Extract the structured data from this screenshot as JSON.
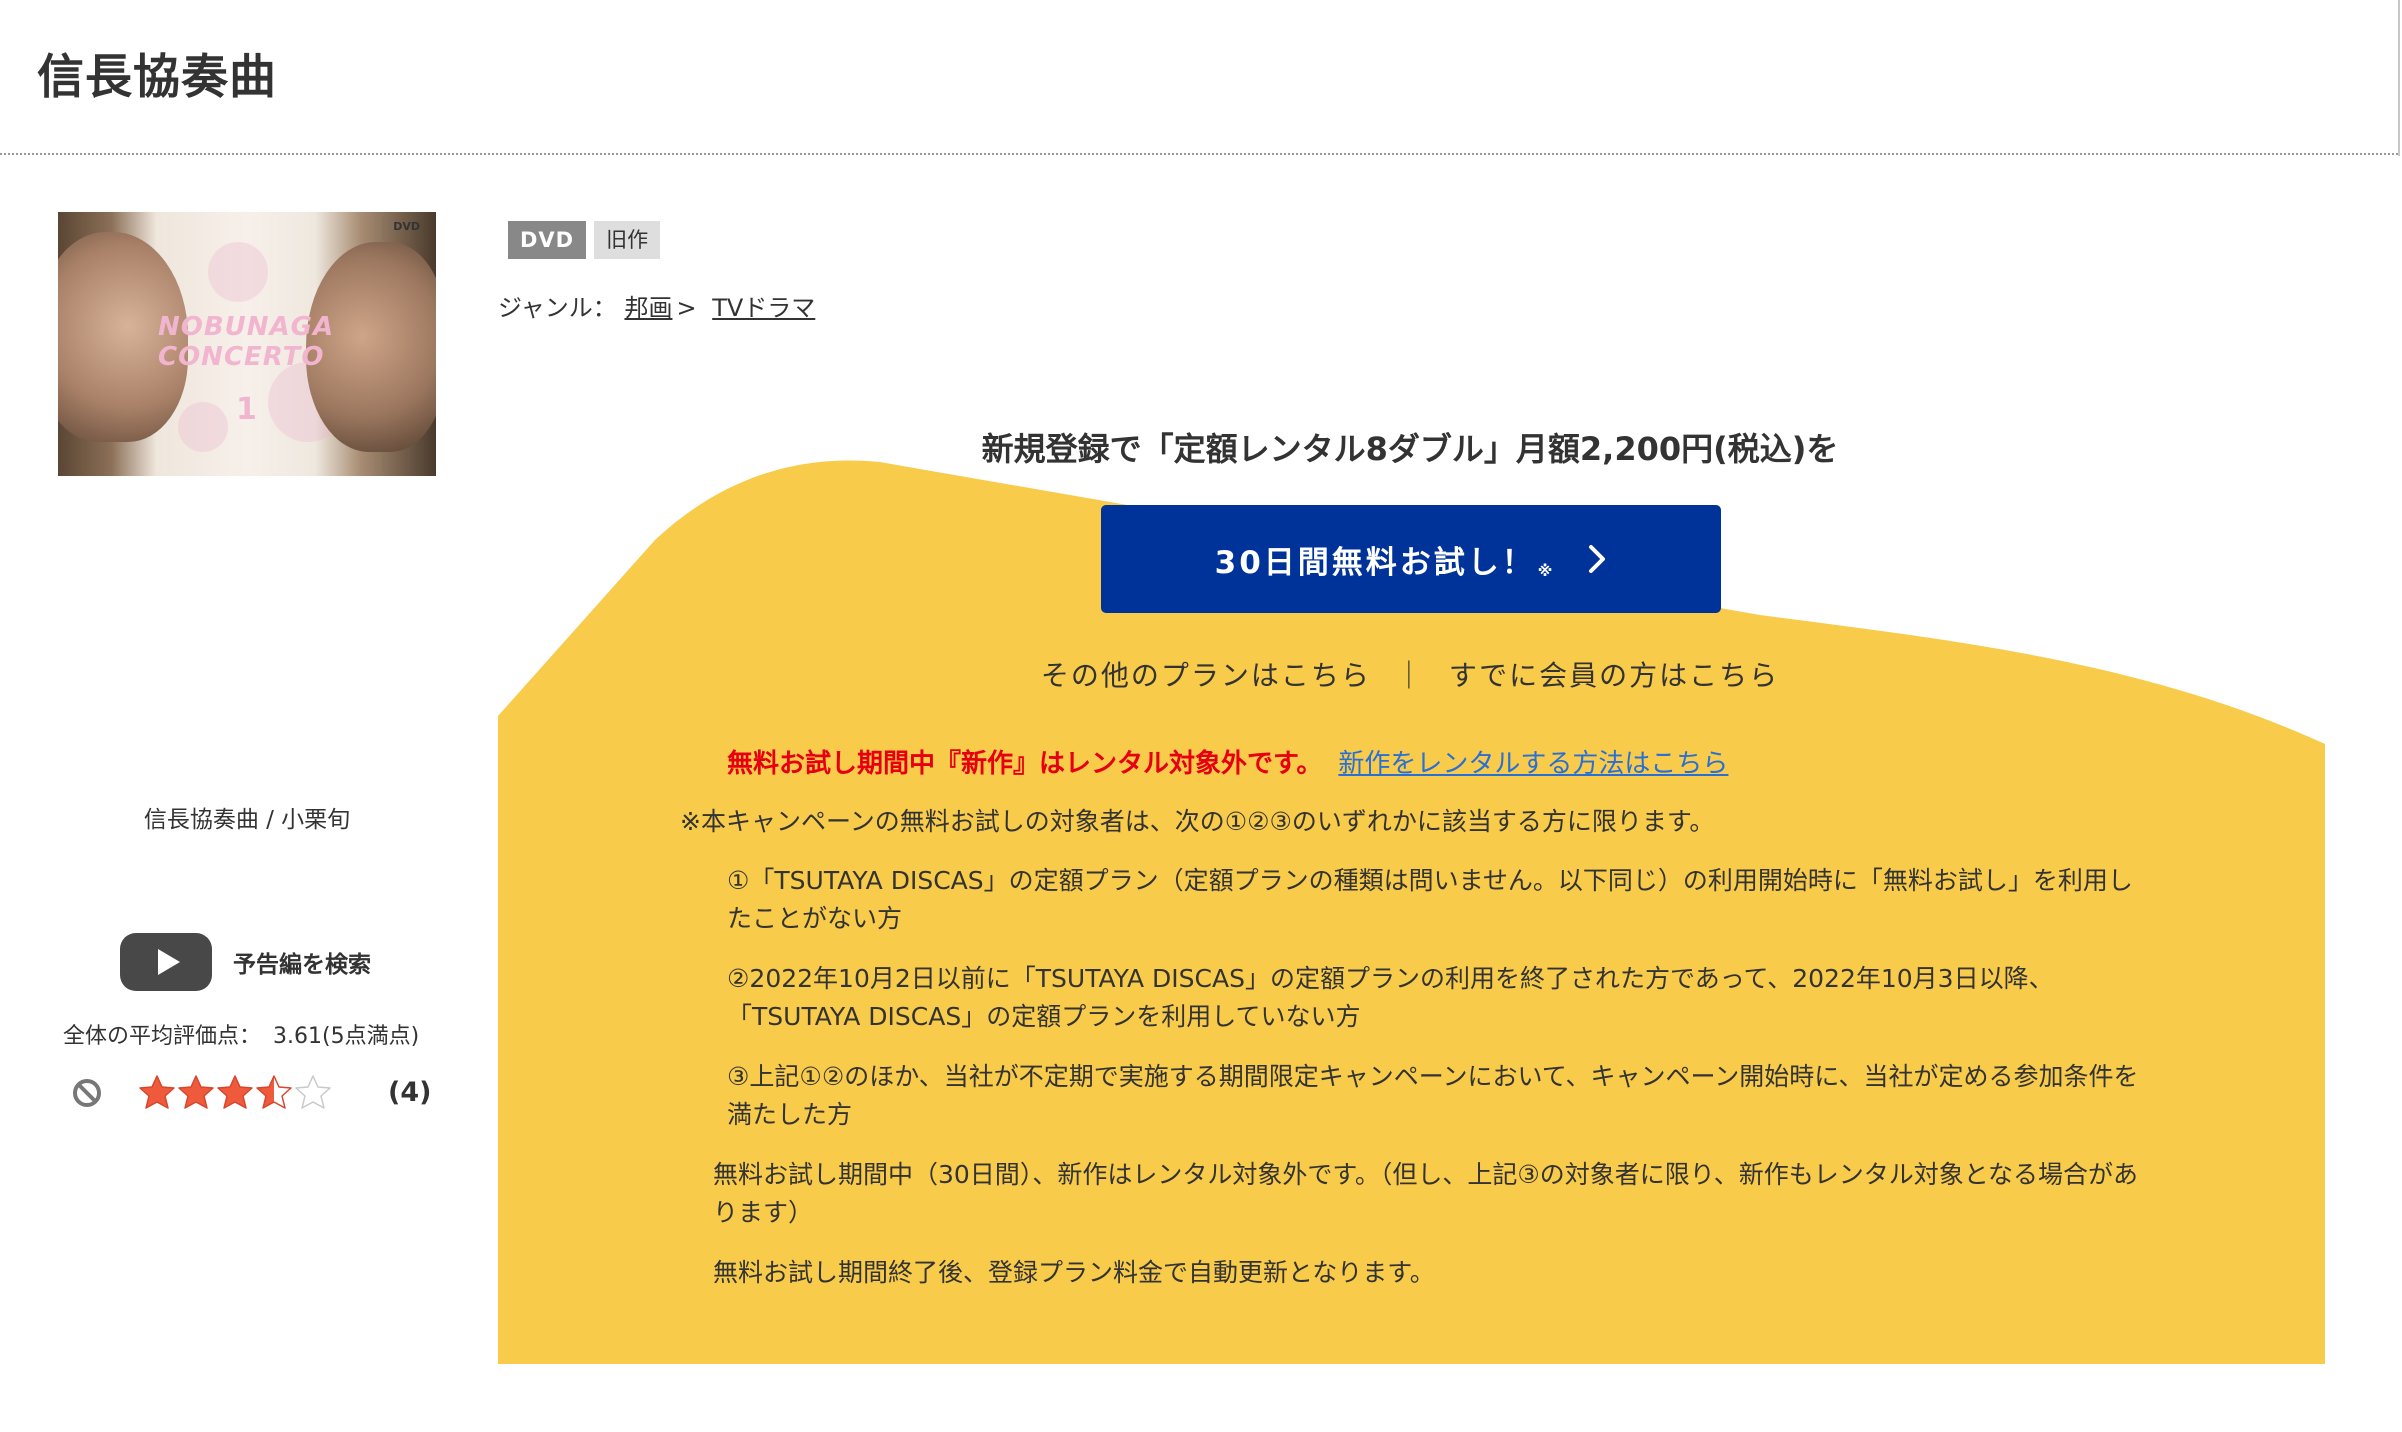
{
  "page": {
    "title": "信長協奏曲"
  },
  "product": {
    "jacket_logo_line1": "NOBUNAGA",
    "jacket_logo_line2": "CONCERTO",
    "jacket_volume": "1",
    "jacket_dvd_mark": "DVD",
    "caption": "信長協奏曲 / 小栗旬",
    "trailer_label": "予告編を検索",
    "average_label": "全体の平均評価点：",
    "average_value": "3.61(5点満点)",
    "rating_stars": 3.5,
    "rating_max": 5,
    "review_count": "(4)"
  },
  "tags": {
    "format": "DVD",
    "status": "旧作"
  },
  "genre": {
    "label": "ジャンル：",
    "level1": "邦画",
    "separator": ">",
    "level2": "TVドラマ"
  },
  "campaign": {
    "headline": "新規登録で「定額レンタル8ダブル」月額2,200円(税込)を",
    "cta_label": "30日間無料お試し！",
    "cta_mark": "※",
    "other_plans_link": "その他のプランはこちら",
    "link_separator": "｜",
    "member_link": "すでに会員の方はこちら",
    "notice_red": "無料お試し期間中『新作』はレンタル対象外です。",
    "notice_link": "新作をレンタルする方法はこちら",
    "note_intro": "※本キャンペーンの無料お試しの対象者は、次の①②③のいずれかに該当する方に限ります。",
    "note_1": "①「TSUTAYA DISCAS」の定額プラン（定額プランの種類は問いません。以下同じ）の利用開始時に「無料お試し」を利用したことがない方",
    "note_2": "②2022年10月2日以前に「TSUTAYA DISCAS」の定額プランの利用を終了された方であって、2022年10月3日以降、「TSUTAYA DISCAS」の定額プランを利用していない方",
    "note_3": "③上記①②のほか、当社が不定期で実施する期間限定キャンペーンにおいて、キャンペーン開始時に、当社が定める参加条件を満たした方",
    "note_4": "無料お試し期間中（30日間）、新作はレンタル対象外です。（但し、上記③の対象者に限り、新作もレンタル対象となる場合があります）",
    "note_5": "無料お試し期間終了後、登録プラン料金で自動更新となります。"
  },
  "colors": {
    "campaign_yellow": "#F8CB4B",
    "cta_blue": "#003399",
    "notice_red": "#E60012",
    "link_blue": "#2A6FD6",
    "star_filled": "#F05A3C"
  }
}
